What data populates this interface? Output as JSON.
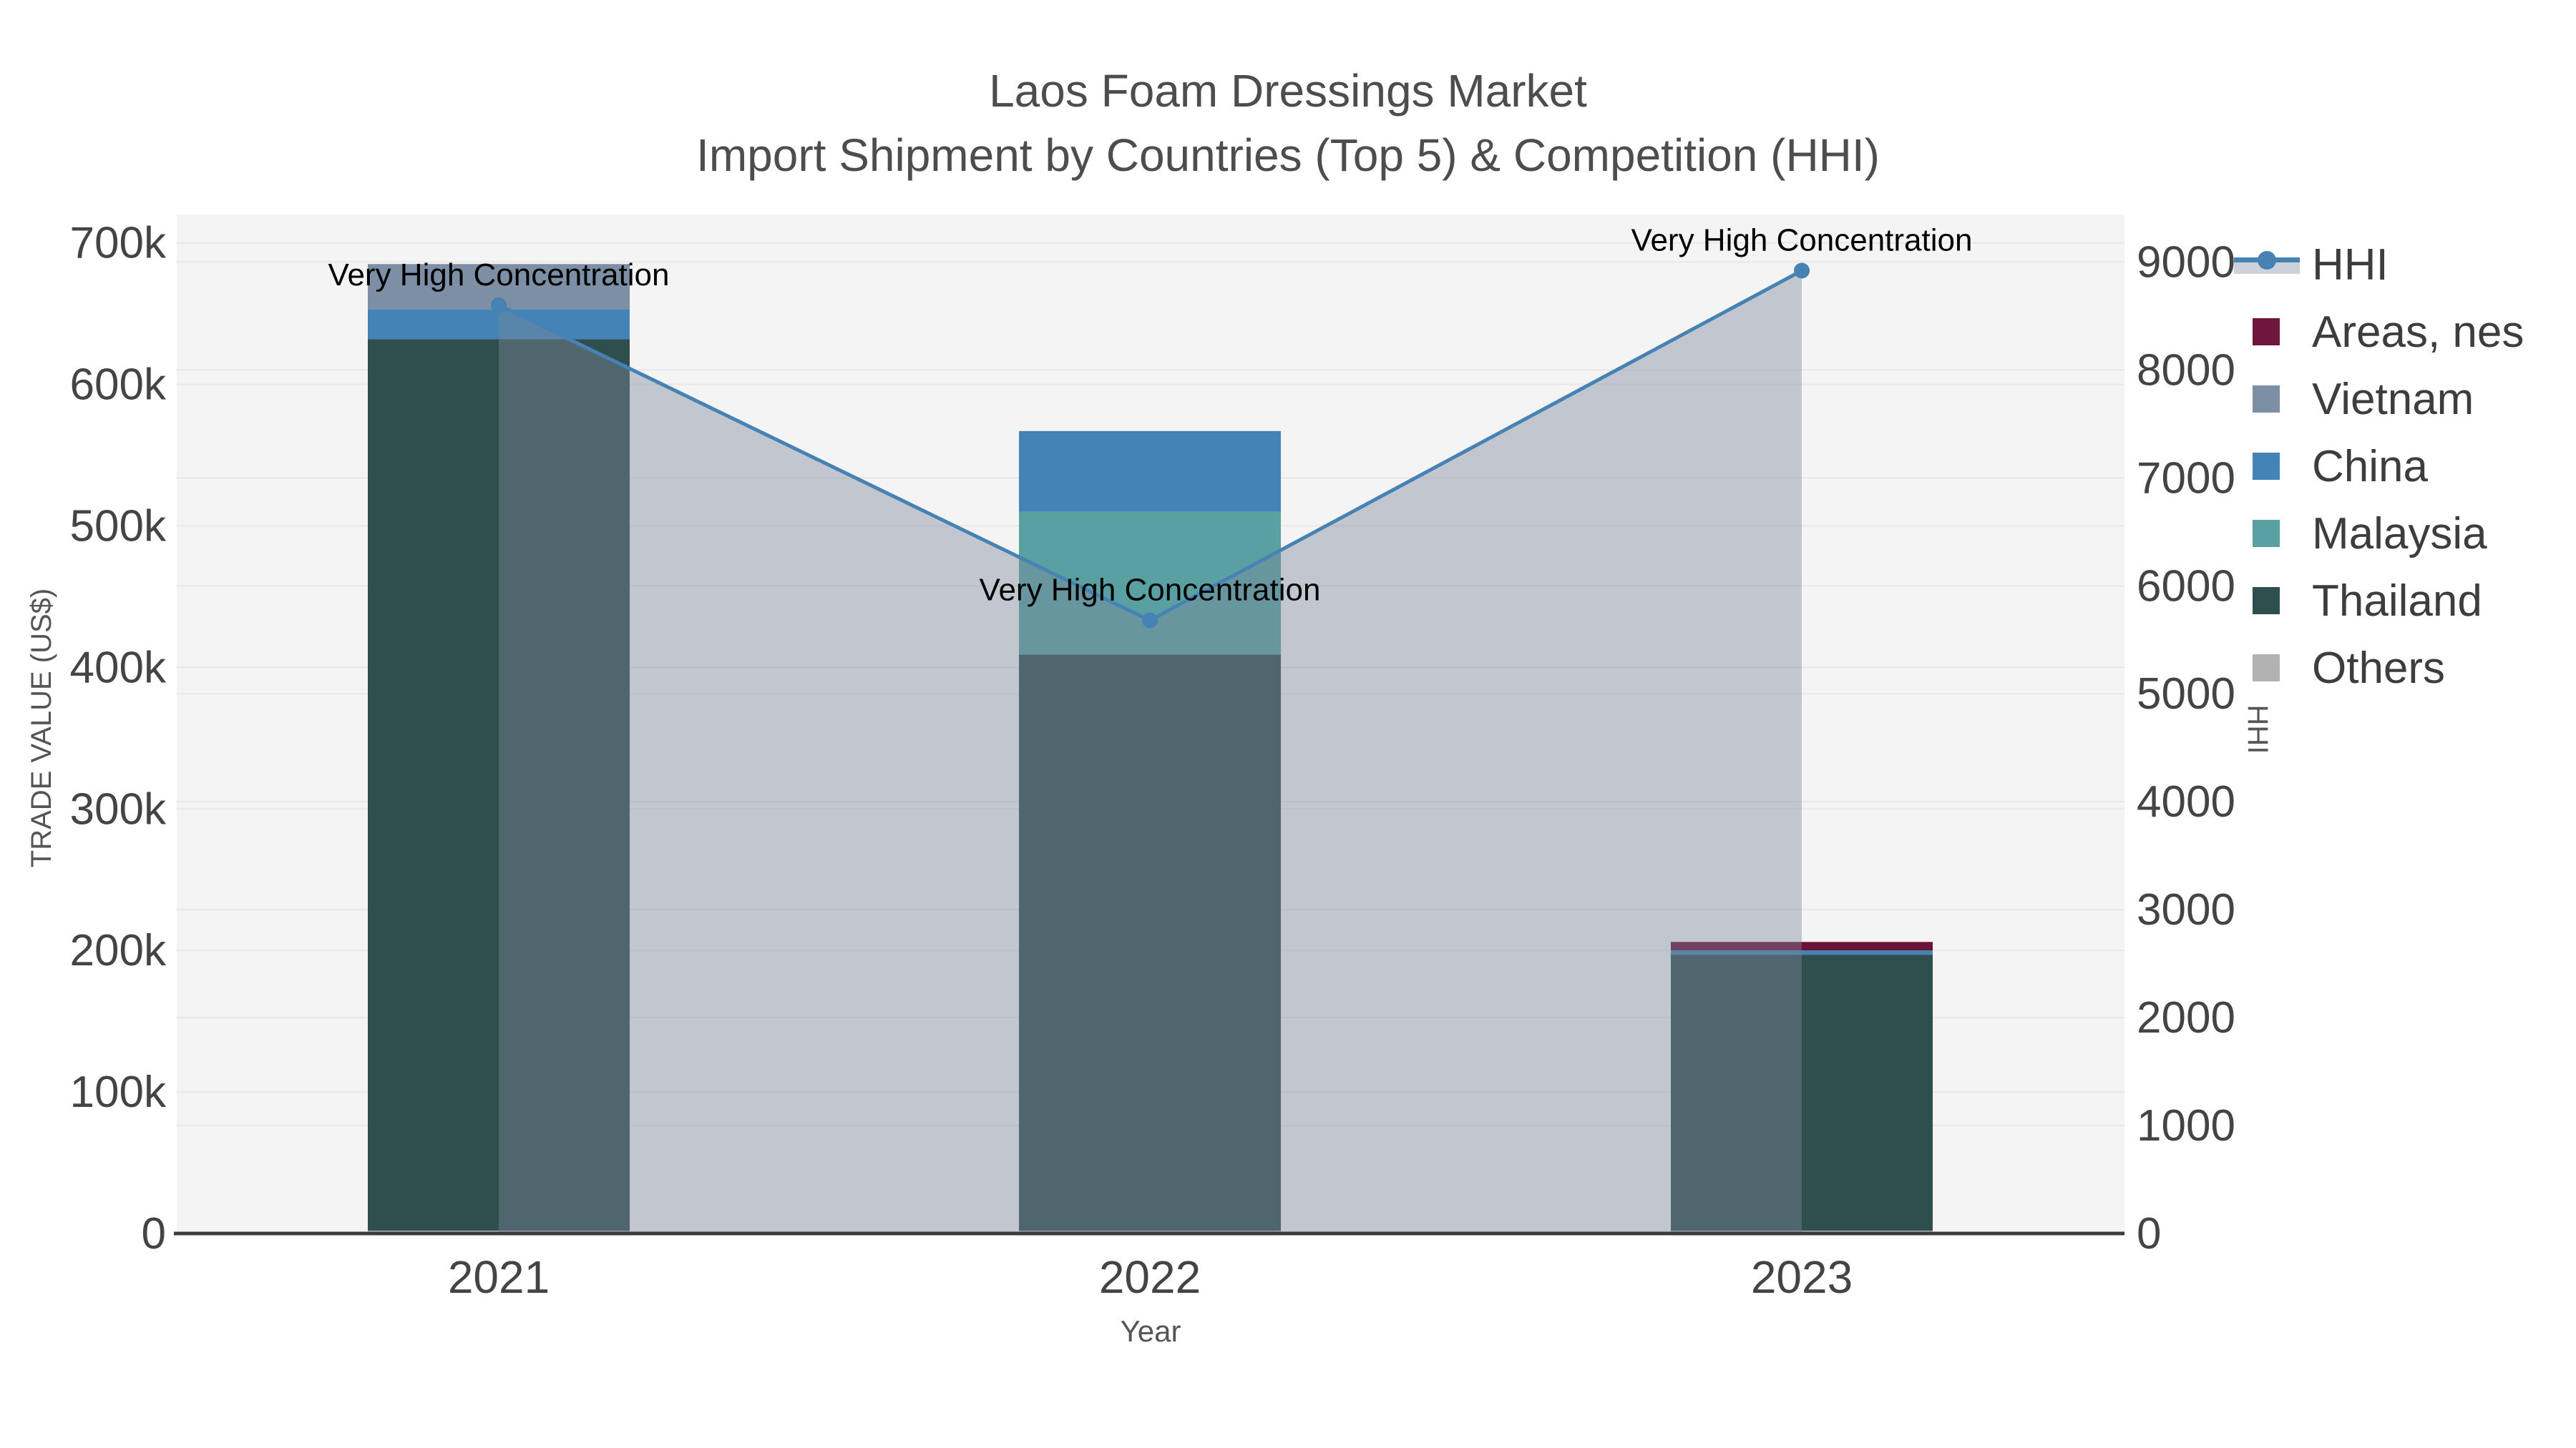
{
  "title": {
    "line1": "Laos Foam Dressings Market",
    "line2": "Import Shipment by Countries (Top 5) & Competition (HHI)"
  },
  "axes": {
    "y_left": {
      "title": "TRADE VALUE (US$)",
      "max": 720000,
      "ticks": [
        {
          "label": "0",
          "value": 0
        },
        {
          "label": "100k",
          "value": 100000
        },
        {
          "label": "200k",
          "value": 200000
        },
        {
          "label": "300k",
          "value": 300000
        },
        {
          "label": "400k",
          "value": 400000
        },
        {
          "label": "500k",
          "value": 500000
        },
        {
          "label": "600k",
          "value": 600000
        },
        {
          "label": "700k",
          "value": 700000
        }
      ]
    },
    "y_right": {
      "title": "HHI",
      "max": 9440,
      "ticks": [
        {
          "label": "0",
          "value": 0
        },
        {
          "label": "1000",
          "value": 1000
        },
        {
          "label": "2000",
          "value": 2000
        },
        {
          "label": "3000",
          "value": 3000
        },
        {
          "label": "4000",
          "value": 4000
        },
        {
          "label": "5000",
          "value": 5000
        },
        {
          "label": "6000",
          "value": 6000
        },
        {
          "label": "7000",
          "value": 7000
        },
        {
          "label": "8000",
          "value": 8000
        },
        {
          "label": "9000",
          "value": 9000
        }
      ]
    },
    "x": {
      "title": "Year"
    }
  },
  "chart_data": {
    "type": "stacked-bar-with-line",
    "categories": [
      "2021",
      "2022",
      "2023"
    ],
    "bar_series_bottom_to_top": [
      {
        "name": "Others",
        "color": "#B2B2B2",
        "values": [
          2000,
          2000,
          2000
        ]
      },
      {
        "name": "Thailand",
        "color": "#2F4F4F",
        "values": [
          630000,
          407000,
          195000
        ]
      },
      {
        "name": "Malaysia",
        "color": "#5AA0A3",
        "values": [
          0,
          101000,
          0
        ]
      },
      {
        "name": "China",
        "color": "#4383B6",
        "values": [
          21000,
          57000,
          3000
        ]
      },
      {
        "name": "Vietnam",
        "color": "#7D8FA4",
        "values": [
          32000,
          0,
          0
        ]
      },
      {
        "name": "Areas, nes",
        "color": "#6B1238",
        "values": [
          0,
          0,
          6000
        ]
      }
    ],
    "bar_totals": [
      685000,
      567000,
      206000
    ],
    "line_series": {
      "name": "HHI",
      "axis": "right",
      "color": "#4682B4",
      "area_fill": "rgba(125,137,155,0.42)",
      "values": [
        8600,
        5680,
        8920
      ]
    },
    "annotations": [
      {
        "text": "Very High Concentration",
        "category": "2021",
        "value": 8600
      },
      {
        "text": "Very High Concentration",
        "category": "2022",
        "value": 5680
      },
      {
        "text": "Very High Concentration",
        "category": "2023",
        "value": 8920
      }
    ],
    "legend_position": "right",
    "grid": true,
    "ylabel_left": "TRADE VALUE (US$)",
    "ylabel_right": "HHI",
    "xlabel": "Year",
    "ylim_left": [
      0,
      720000
    ],
    "ylim_right": [
      0,
      9440
    ]
  },
  "legend": {
    "items": [
      {
        "label": "HHI",
        "swatch": "line",
        "color": "#4682B4",
        "band": "#CDD1D9"
      },
      {
        "label": "Areas, nes",
        "swatch": "box",
        "color": "#6E163C"
      },
      {
        "label": "Vietnam",
        "swatch": "box",
        "color": "#7D8FA4"
      },
      {
        "label": "China",
        "swatch": "box",
        "color": "#4383B6"
      },
      {
        "label": "Malaysia",
        "swatch": "box",
        "color": "#5AA0A3"
      },
      {
        "label": "Thailand",
        "swatch": "box",
        "color": "#2F4F4F"
      },
      {
        "label": "Others",
        "swatch": "box",
        "color": "#B2B2B2"
      }
    ]
  },
  "colors": {
    "page_bg": "#ffffff",
    "plot_bg": "#f4f4f4",
    "grid": "#e7e8e8",
    "axis_line": "#3b3b3b",
    "tick_text": "#444444",
    "title_text": "#4d4d4d",
    "axis_title_text": "#555555",
    "annotation_text": "#000000"
  }
}
